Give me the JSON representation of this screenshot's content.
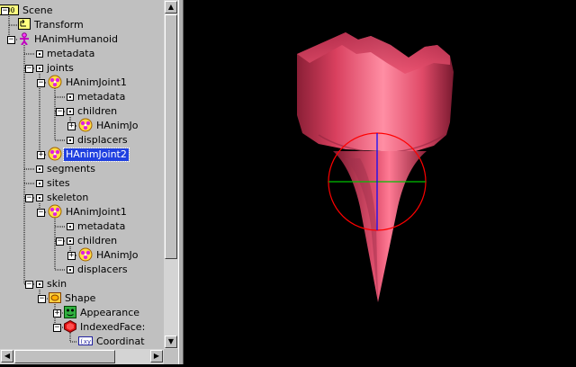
{
  "tree": {
    "nodes": [
      {
        "label": "Scene",
        "icon": "scene-icon",
        "indent": 0,
        "expander": "minus"
      },
      {
        "label": "Transform",
        "icon": "transform-icon",
        "indent": 1,
        "expander": ""
      },
      {
        "label": "HAnimHumanoid",
        "icon": "humanoid-icon",
        "indent": 1,
        "expander": "minus"
      },
      {
        "label": "metadata",
        "icon": "field-icon",
        "indent": 2,
        "expander": ""
      },
      {
        "label": "joints",
        "icon": "field-icon",
        "indent": 2,
        "expander": "minus"
      },
      {
        "label": "HAnimJoint1",
        "icon": "joint-icon",
        "indent": 3,
        "expander": "minus"
      },
      {
        "label": "metadata",
        "icon": "field-icon",
        "indent": 4,
        "expander": ""
      },
      {
        "label": "children",
        "icon": "field-icon",
        "indent": 4,
        "expander": "minus"
      },
      {
        "label": "HAnimJo",
        "icon": "joint-icon",
        "indent": 5,
        "expander": "plus"
      },
      {
        "label": "displacers",
        "icon": "field-icon",
        "indent": 4,
        "expander": ""
      },
      {
        "label": "HAnimJoint2",
        "icon": "joint-icon",
        "indent": 3,
        "expander": "plus",
        "selected": true
      },
      {
        "label": "segments",
        "icon": "field-icon",
        "indent": 2,
        "expander": ""
      },
      {
        "label": "sites",
        "icon": "field-icon",
        "indent": 2,
        "expander": ""
      },
      {
        "label": "skeleton",
        "icon": "field-icon",
        "indent": 2,
        "expander": "minus"
      },
      {
        "label": "HAnimJoint1",
        "icon": "joint-icon",
        "indent": 3,
        "expander": "minus"
      },
      {
        "label": "metadata",
        "icon": "field-icon",
        "indent": 4,
        "expander": ""
      },
      {
        "label": "children",
        "icon": "field-icon",
        "indent": 4,
        "expander": "minus"
      },
      {
        "label": "HAnimJo",
        "icon": "joint-icon",
        "indent": 5,
        "expander": "plus"
      },
      {
        "label": "displacers",
        "icon": "field-icon",
        "indent": 4,
        "expander": ""
      },
      {
        "label": "skin",
        "icon": "field-icon",
        "indent": 2,
        "expander": "minus"
      },
      {
        "label": "Shape",
        "icon": "shape-icon",
        "indent": 3,
        "expander": "minus"
      },
      {
        "label": "Appearance",
        "icon": "appearance-icon",
        "indent": 4,
        "expander": "plus"
      },
      {
        "label": "IndexedFace:",
        "icon": "geometry-icon",
        "indent": 4,
        "expander": "minus"
      },
      {
        "label": "Coordinat",
        "icon": "coordinate-icon",
        "indent": 5,
        "expander": ""
      }
    ]
  },
  "viewport": {
    "object_color": "#e8506e",
    "manipulator": {
      "ring_color": "#ff0000",
      "x_axis_color": "#00c000",
      "y_axis_color": "#0000ff"
    }
  }
}
